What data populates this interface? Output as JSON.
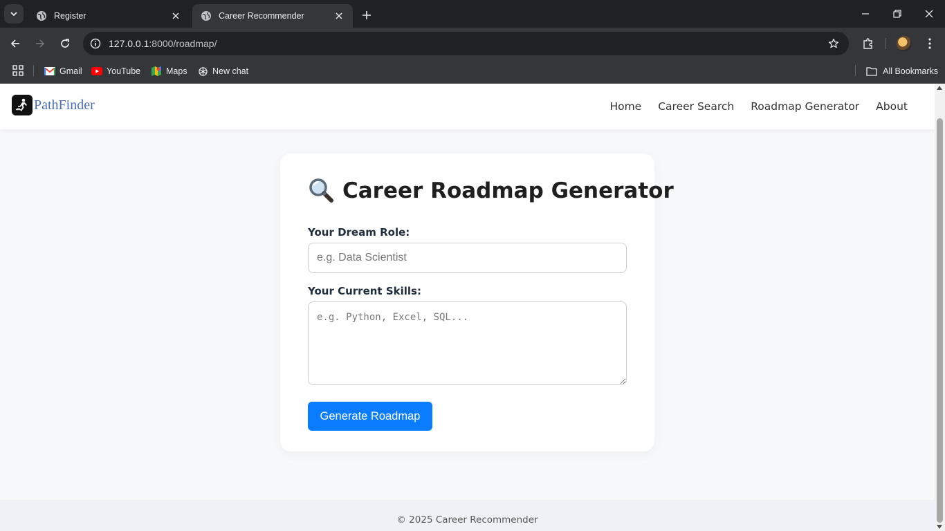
{
  "browser": {
    "tabs": [
      {
        "title": "Register",
        "active": false
      },
      {
        "title": "Career Recommender",
        "active": true
      }
    ],
    "url_host": "127.0.0.1",
    "url_rest": ":8000/roadmap/",
    "bookmarks": [
      {
        "label": "Gmail",
        "icon": "gmail-icon"
      },
      {
        "label": "YouTube",
        "icon": "youtube-icon"
      },
      {
        "label": "Maps",
        "icon": "maps-icon"
      },
      {
        "label": "New chat",
        "icon": "chatgpt-icon"
      }
    ],
    "all_bookmarks": "All Bookmarks"
  },
  "site": {
    "logo_text": "PathFinder",
    "nav": [
      "Home",
      "Career Search",
      "Roadmap Generator",
      "About"
    ]
  },
  "form": {
    "heading": "Career Roadmap Generator",
    "heading_icon": "magnifier-icon",
    "role_label": "Your Dream Role:",
    "role_placeholder": "e.g. Data Scientist",
    "skills_label": "Your Current Skills:",
    "skills_placeholder": "e.g. Python, Excel, SQL...",
    "submit_label": "Generate Roadmap",
    "accent_color": "#0a7cff"
  },
  "footer": {
    "text": "© 2025 Career Recommender"
  }
}
